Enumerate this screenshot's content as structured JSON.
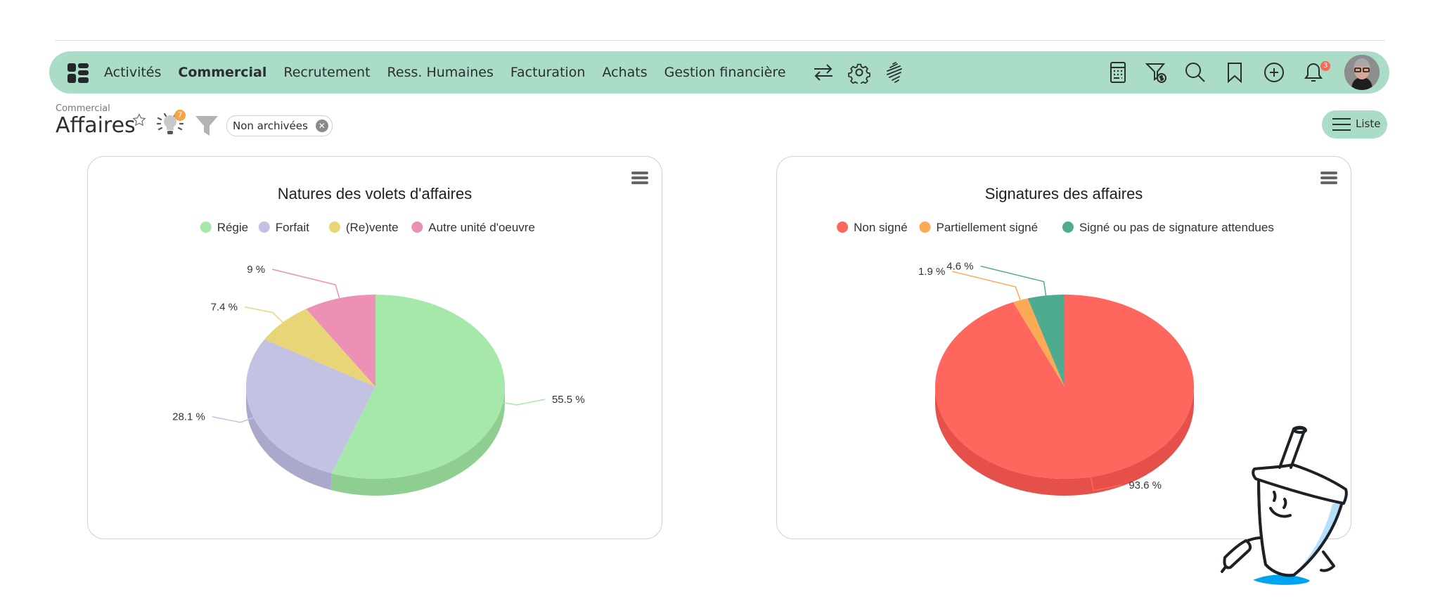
{
  "nav": {
    "items": [
      {
        "label": "Activités",
        "active": false
      },
      {
        "label": "Commercial",
        "active": true
      },
      {
        "label": "Recrutement",
        "active": false
      },
      {
        "label": "Ress. Humaines",
        "active": false
      },
      {
        "label": "Facturation",
        "active": false
      },
      {
        "label": "Achats",
        "active": false
      },
      {
        "label": "Gestion financière",
        "active": false
      }
    ],
    "notification_count": "3",
    "accent": "#abdcc5"
  },
  "page": {
    "breadcrumb": "Commercial",
    "title": "Affaires",
    "tips_count": "7",
    "filter_chip": "Non archivées",
    "view_button": "Liste"
  },
  "chart_data": [
    {
      "type": "pie",
      "title": "Natures des volets d'affaires",
      "legend_position": "top",
      "categories": [
        "Régie",
        "Forfait",
        "(Re)vente",
        "Autre unité d'oeuvre"
      ],
      "values": [
        55.5,
        28.1,
        7.4,
        9
      ],
      "labels": [
        "55.5 %",
        "28.1 %",
        "7.4 %",
        "9 %"
      ],
      "colors": [
        "#a6e8a9",
        "#c3c2e3",
        "#e8d578",
        "#ec90b5"
      ],
      "side_colors": [
        "#8ecf91",
        "#aaa8cb",
        "#cfbd62",
        "#d27a9d"
      ]
    },
    {
      "type": "pie",
      "title": "Signatures des affaires",
      "legend_position": "top",
      "categories": [
        "Non signé",
        "Partiellement signé",
        "Signé ou pas de signature attendues"
      ],
      "values": [
        93.6,
        1.9,
        4.6
      ],
      "labels": [
        "93.6 %",
        "1.9 %",
        "4.6 %"
      ],
      "colors": [
        "#fe665e",
        "#fdaa55",
        "#4eab90"
      ],
      "side_colors": [
        "#e5504a",
        "#e39443",
        "#3f957b"
      ]
    }
  ]
}
